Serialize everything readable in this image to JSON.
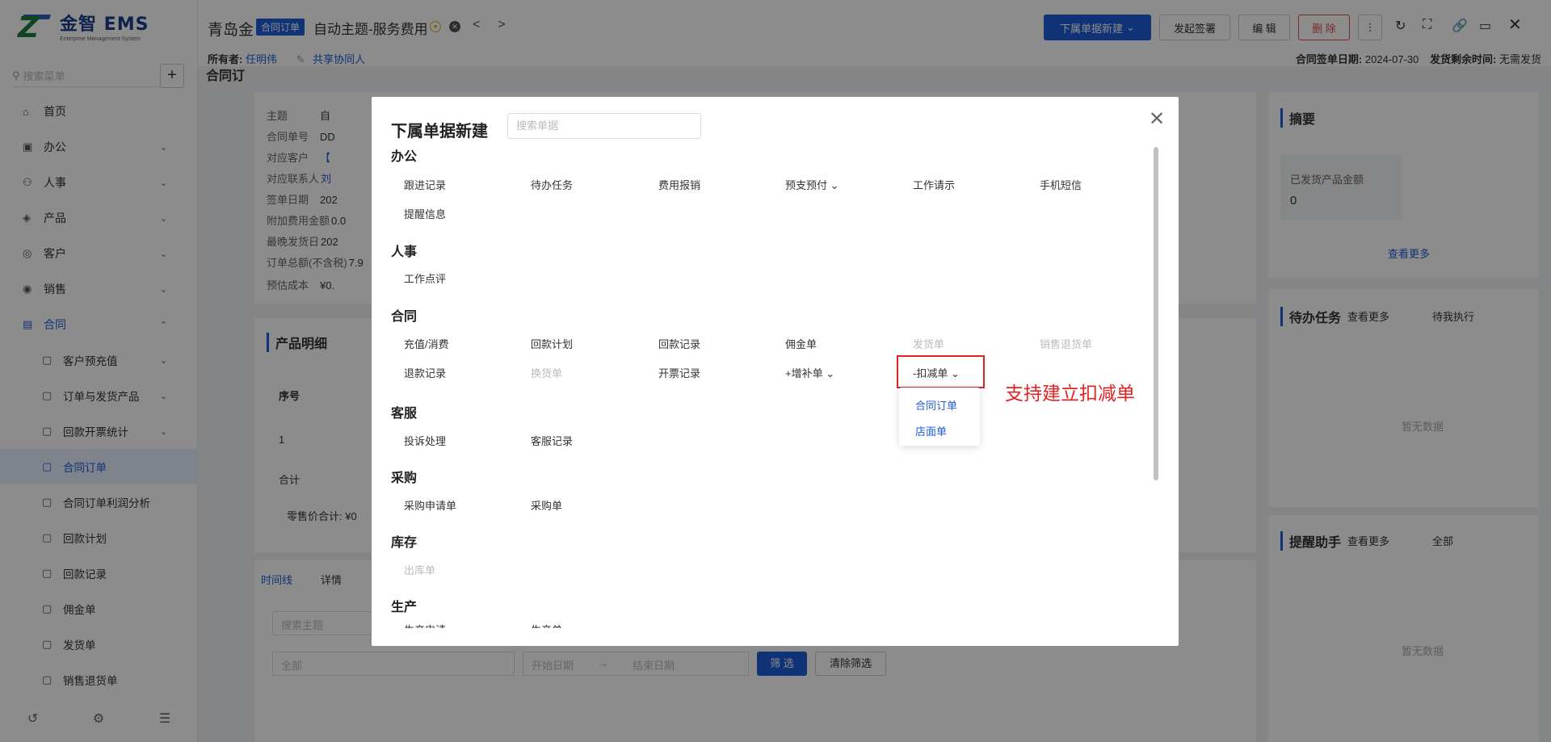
{
  "app": {
    "logo_title": "金智 EMS",
    "logo_subtitle": "Enterprise Management System"
  },
  "sidebar": {
    "search_placeholder": "搜索菜单",
    "items": [
      {
        "label": "首页",
        "icon": "home-icon"
      },
      {
        "label": "办公",
        "icon": "briefcase-icon"
      },
      {
        "label": "人事",
        "icon": "people-icon"
      },
      {
        "label": "产品",
        "icon": "box-icon"
      },
      {
        "label": "客户",
        "icon": "customer-icon"
      },
      {
        "label": "销售",
        "icon": "sales-icon"
      },
      {
        "label": "合同",
        "icon": "contract-icon"
      }
    ],
    "sub_items": [
      {
        "label": "客户预充值"
      },
      {
        "label": "订单与发货产品"
      },
      {
        "label": "回款开票统计"
      },
      {
        "label": "合同订单"
      },
      {
        "label": "合同订单利润分析"
      },
      {
        "label": "回款计划"
      },
      {
        "label": "回款记录"
      },
      {
        "label": "佣金单"
      },
      {
        "label": "发货单"
      },
      {
        "label": "销售退货单"
      }
    ]
  },
  "header": {
    "company": "青岛金",
    "tag": "合同订单",
    "title": "自动主题-服务费用",
    "owner_label": "所有者:",
    "owner_name": "任明伟",
    "share_label": "共享协同人",
    "sign_date_label": "合同签单日期:",
    "sign_date": "2024-07-30",
    "ship_remaining_label": "发货剩余时间:",
    "ship_remaining": "无需发货",
    "buttons": {
      "new_sub": "下属单据新建",
      "sign": "发起签署",
      "edit": "编 辑",
      "delete": "删 除"
    }
  },
  "background": {
    "page_title": "合同订",
    "fields": [
      {
        "label": "主题",
        "value": "自"
      },
      {
        "label": "合同单号",
        "value": "DD"
      },
      {
        "label": "对应客户",
        "value": "【"
      },
      {
        "label": "对应联系人",
        "value": "刘"
      },
      {
        "label": "签单日期",
        "value": "202"
      },
      {
        "label": "附加费用金额",
        "value": "0.0"
      },
      {
        "label": "最晚发货日",
        "value": "202"
      },
      {
        "label": "订单总额(不含税)",
        "value": "7.9"
      },
      {
        "label": "预估成本",
        "value": "¥0."
      }
    ],
    "product_detail": "产品明细",
    "col_index": "序号",
    "row_1": "1",
    "total": "合计",
    "retail_total": "零售价合计: ¥0",
    "tabs": [
      "时间线",
      "详情"
    ],
    "search_topic": "搜索主题",
    "filter_all": "全部",
    "start_date": "开始日期",
    "end_date": "结束日期",
    "filter_btn": "筛 选",
    "clear_btn": "清除筛选",
    "summary_title": "摘要",
    "shipped_amount_label": "已发货产品金额",
    "shipped_amount": "0",
    "view_more": "查看更多",
    "todo_title": "待办任务",
    "todo_filter": "待我执行",
    "reminder_title": "提醒助手",
    "reminder_filter": "全部",
    "no_data": "暂无数据"
  },
  "modal": {
    "title": "下属单据新建",
    "search_placeholder": "搜索单据",
    "sections": [
      {
        "title": "办公",
        "items": [
          "跟进记录",
          "待办任务",
          "费用报销",
          "预支预付",
          "工作请示",
          "手机短信",
          "提醒信息"
        ]
      },
      {
        "title": "人事",
        "items": [
          "工作点评"
        ]
      },
      {
        "title": "合同",
        "items": [
          "充值/消费",
          "回款计划",
          "回款记录",
          "佣金单",
          "发货单",
          "销售退货单",
          "退款记录",
          "换货单",
          "开票记录",
          "+增补单",
          "-扣减单"
        ]
      },
      {
        "title": "客服",
        "items": [
          "投诉处理",
          "客服记录"
        ]
      },
      {
        "title": "采购",
        "items": [
          "采购申请单",
          "采购单"
        ]
      },
      {
        "title": "库存",
        "items": [
          "出库单"
        ]
      },
      {
        "title": "生产",
        "items": [
          "生产申请",
          "生产单"
        ]
      }
    ],
    "dropdown": [
      "合同订单",
      "店面单"
    ]
  },
  "annotation": "支持建立扣减单"
}
